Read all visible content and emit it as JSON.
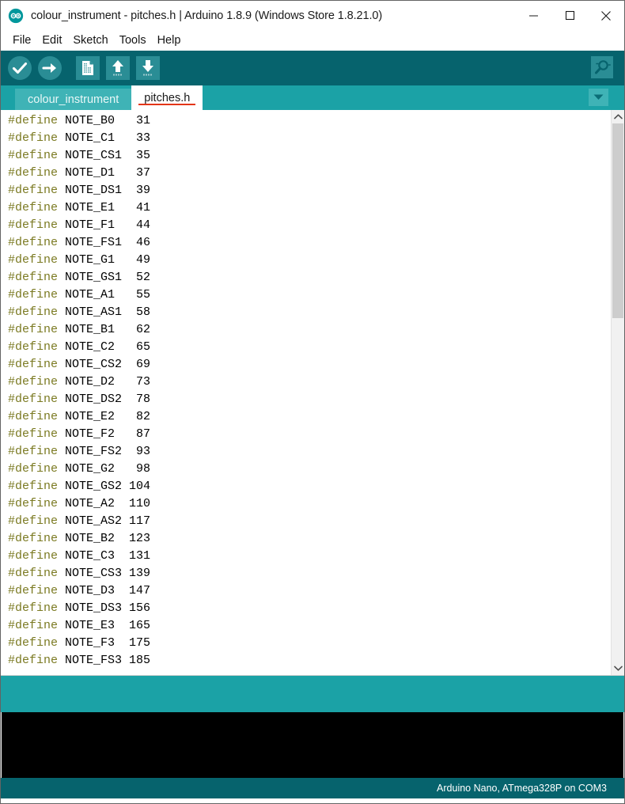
{
  "window": {
    "title": "colour_instrument - pitches.h | Arduino 1.8.9 (Windows Store 1.8.21.0)",
    "logo_icon": "arduino-infinity-logo",
    "controls": [
      {
        "name": "minimize",
        "icon": "minimize-icon"
      },
      {
        "name": "maximize",
        "icon": "maximize-icon"
      },
      {
        "name": "close",
        "icon": "close-icon"
      }
    ]
  },
  "menubar": {
    "items": [
      {
        "label": "File"
      },
      {
        "label": "Edit"
      },
      {
        "label": "Sketch"
      },
      {
        "label": "Tools"
      },
      {
        "label": "Help"
      }
    ]
  },
  "toolbar": {
    "buttons": [
      {
        "name": "verify",
        "icon": "check-circle-icon",
        "tooltip": "Verify"
      },
      {
        "name": "upload",
        "icon": "arrow-right-circle-icon",
        "tooltip": "Upload"
      },
      {
        "name": "new",
        "icon": "new-document-icon",
        "tooltip": "New"
      },
      {
        "name": "open",
        "icon": "arrow-up-icon",
        "tooltip": "Open"
      },
      {
        "name": "save",
        "icon": "arrow-down-icon",
        "tooltip": "Save"
      }
    ],
    "serial_monitor": {
      "name": "serial-monitor",
      "icon": "magnifier-icon",
      "tooltip": "Serial Monitor"
    }
  },
  "tabs": {
    "items": [
      {
        "label": "colour_instrument",
        "active": false
      },
      {
        "label": "pitches.h",
        "active": true
      }
    ],
    "menu_icon": "chevron-down-icon",
    "active_underline_color": "#e33517"
  },
  "editor": {
    "keyword": "#define",
    "lines": [
      {
        "name": "NOTE_B0",
        "value": "31"
      },
      {
        "name": "NOTE_C1",
        "value": "33"
      },
      {
        "name": "NOTE_CS1",
        "value": "35"
      },
      {
        "name": "NOTE_D1",
        "value": "37"
      },
      {
        "name": "NOTE_DS1",
        "value": "39"
      },
      {
        "name": "NOTE_E1",
        "value": "41"
      },
      {
        "name": "NOTE_F1",
        "value": "44"
      },
      {
        "name": "NOTE_FS1",
        "value": "46"
      },
      {
        "name": "NOTE_G1",
        "value": "49"
      },
      {
        "name": "NOTE_GS1",
        "value": "52"
      },
      {
        "name": "NOTE_A1",
        "value": "55"
      },
      {
        "name": "NOTE_AS1",
        "value": "58"
      },
      {
        "name": "NOTE_B1",
        "value": "62"
      },
      {
        "name": "NOTE_C2",
        "value": "65"
      },
      {
        "name": "NOTE_CS2",
        "value": "69"
      },
      {
        "name": "NOTE_D2",
        "value": "73"
      },
      {
        "name": "NOTE_DS2",
        "value": "78"
      },
      {
        "name": "NOTE_E2",
        "value": "82"
      },
      {
        "name": "NOTE_F2",
        "value": "87"
      },
      {
        "name": "NOTE_FS2",
        "value": "93"
      },
      {
        "name": "NOTE_G2",
        "value": "98"
      },
      {
        "name": "NOTE_GS2",
        "value": "104"
      },
      {
        "name": "NOTE_A2",
        "value": "110"
      },
      {
        "name": "NOTE_AS2",
        "value": "117"
      },
      {
        "name": "NOTE_B2",
        "value": "123"
      },
      {
        "name": "NOTE_C3",
        "value": "131"
      },
      {
        "name": "NOTE_CS3",
        "value": "139"
      },
      {
        "name": "NOTE_D3",
        "value": "147"
      },
      {
        "name": "NOTE_DS3",
        "value": "156"
      },
      {
        "name": "NOTE_E3",
        "value": "165"
      },
      {
        "name": "NOTE_F3",
        "value": "175"
      },
      {
        "name": "NOTE_FS3",
        "value": "185"
      }
    ],
    "keyword_color": "#7b7a22",
    "text_color": "#000000",
    "scrollbar": {
      "up_icon": "chevron-up-icon",
      "down_icon": "chevron-down-icon"
    }
  },
  "console": {
    "text": ""
  },
  "statusbar": {
    "board": "Arduino Nano, ATmega328P on COM3"
  },
  "colors": {
    "toolbar_bg": "#06636d",
    "tabbar_bg": "#1ba2a6",
    "tab_inactive_bg": "#3fb3b6",
    "console_bg": "#000000",
    "accent_red": "#e33517"
  }
}
